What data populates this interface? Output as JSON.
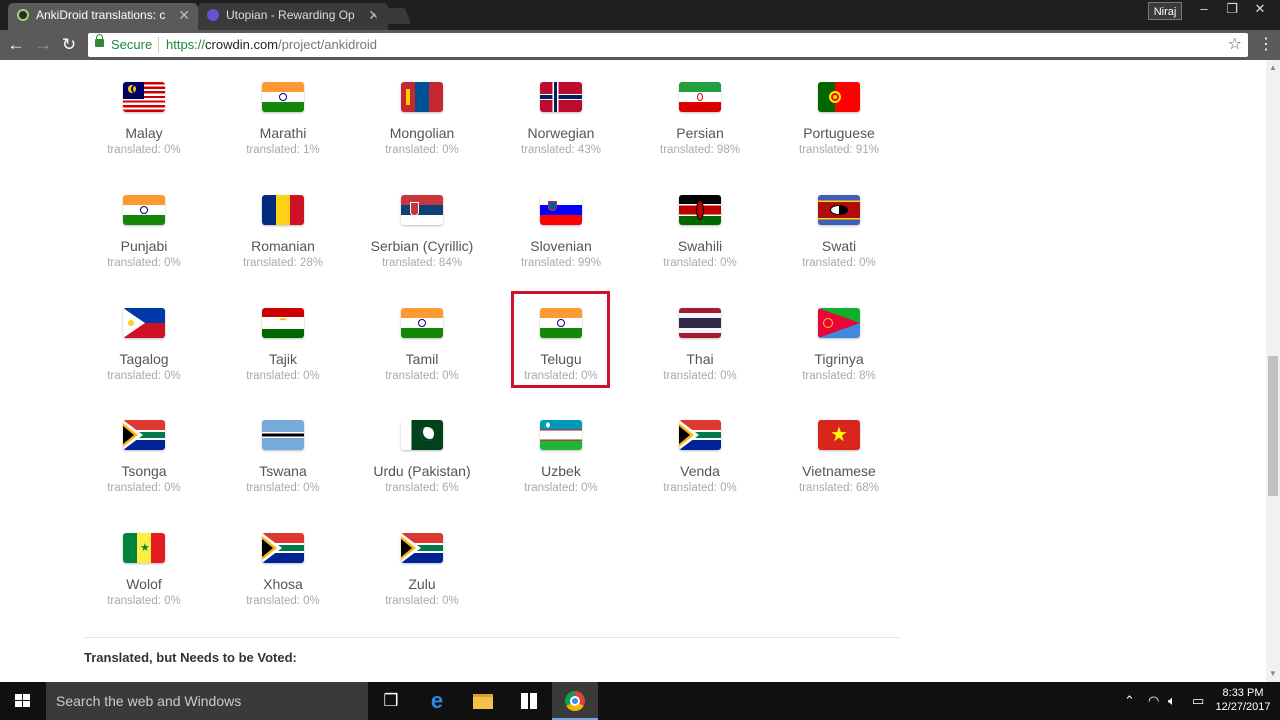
{
  "browser": {
    "tabs": [
      {
        "title": "AnkiDroid translations: c",
        "active": true
      },
      {
        "title": "Utopian - Rewarding Op",
        "active": false
      }
    ],
    "user": "Niraj",
    "secure_label": "Secure",
    "url_proto": "https://",
    "url_host": "crowdin.com",
    "url_path": "/project/ankidroid"
  },
  "languages": [
    {
      "name": "Malay",
      "translated": "translated: 0%",
      "flag": "malaysia"
    },
    {
      "name": "Marathi",
      "translated": "translated: 1%",
      "flag": "india"
    },
    {
      "name": "Mongolian",
      "translated": "translated: 0%",
      "flag": "mongolia"
    },
    {
      "name": "Norwegian",
      "translated": "translated: 43%",
      "flag": "norway"
    },
    {
      "name": "Persian",
      "translated": "translated: 98%",
      "flag": "iran"
    },
    {
      "name": "Portuguese",
      "translated": "translated: 91%",
      "flag": "portugal"
    },
    {
      "name": "Punjabi",
      "translated": "translated: 0%",
      "flag": "india"
    },
    {
      "name": "Romanian",
      "translated": "translated: 28%",
      "flag": "romania"
    },
    {
      "name": "Serbian (Cyrillic)",
      "translated": "translated: 84%",
      "flag": "serbia"
    },
    {
      "name": "Slovenian",
      "translated": "translated: 99%",
      "flag": "slovenia"
    },
    {
      "name": "Swahili",
      "translated": "translated: 0%",
      "flag": "kenya"
    },
    {
      "name": "Swati",
      "translated": "translated: 0%",
      "flag": "eswatini"
    },
    {
      "name": "Tagalog",
      "translated": "translated: 0%",
      "flag": "philippines"
    },
    {
      "name": "Tajik",
      "translated": "translated: 0%",
      "flag": "tajikistan"
    },
    {
      "name": "Tamil",
      "translated": "translated: 0%",
      "flag": "india"
    },
    {
      "name": "Telugu",
      "translated": "translated: 0%",
      "flag": "india"
    },
    {
      "name": "Thai",
      "translated": "translated: 0%",
      "flag": "thailand"
    },
    {
      "name": "Tigrinya",
      "translated": "translated: 8%",
      "flag": "eritrea"
    },
    {
      "name": "Tsonga",
      "translated": "translated: 0%",
      "flag": "southafrica"
    },
    {
      "name": "Tswana",
      "translated": "translated: 0%",
      "flag": "botswana"
    },
    {
      "name": "Urdu (Pakistan)",
      "translated": "translated: 6%",
      "flag": "pakistan"
    },
    {
      "name": "Uzbek",
      "translated": "translated: 0%",
      "flag": "uzbekistan"
    },
    {
      "name": "Venda",
      "translated": "translated: 0%",
      "flag": "southafrica"
    },
    {
      "name": "Vietnamese",
      "translated": "translated: 68%",
      "flag": "vietnam"
    },
    {
      "name": "Wolof",
      "translated": "translated: 0%",
      "flag": "senegal"
    },
    {
      "name": "Xhosa",
      "translated": "translated: 0%",
      "flag": "southafrica"
    },
    {
      "name": "Zulu",
      "translated": "translated: 0%",
      "flag": "southafrica"
    }
  ],
  "highlighted_language": "Telugu",
  "section_title": "Translated, but Needs to be Voted:",
  "taskbar": {
    "search_placeholder": "Search the web and Windows",
    "time": "8:33 PM",
    "date": "12/27/2017"
  },
  "colors": {
    "highlight_border": "#d0112b",
    "secure_green": "#1f8a3a"
  }
}
